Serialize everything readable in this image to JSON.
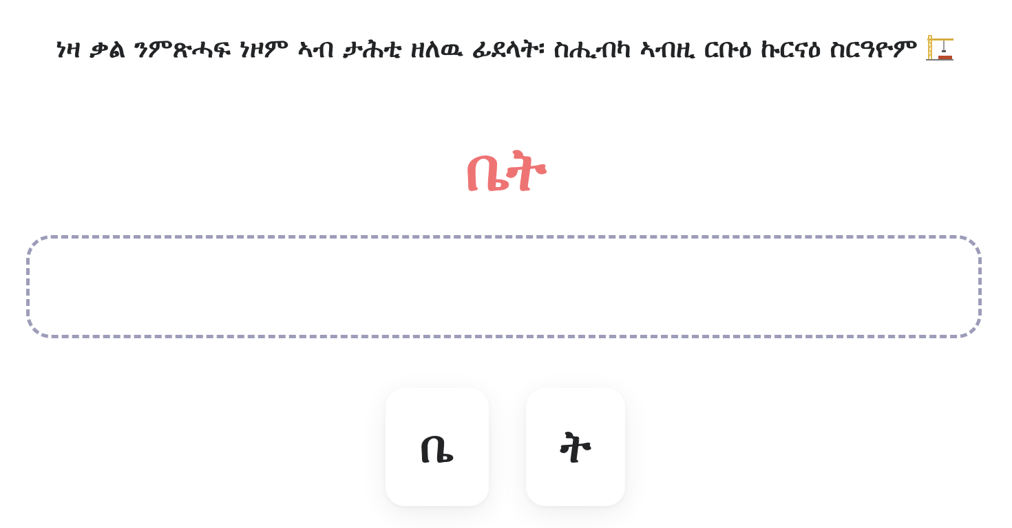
{
  "instruction": {
    "text": "ነዛ ቃል ንምጽሓፍ ነዞም ኣብ ታሕቲ ዘለዉ ፊደላት፡ ስሒብካ ኣብዚ ርቡዕ ኩርናዕ ስርዓዮም",
    "icon": "construction-crane-icon"
  },
  "target_word": "ቤት",
  "colors": {
    "target": "#ee7474",
    "drop_border": "#9d9cb9",
    "text": "#222426"
  },
  "tiles": [
    {
      "letter": "ቤ"
    },
    {
      "letter": "ት"
    }
  ]
}
